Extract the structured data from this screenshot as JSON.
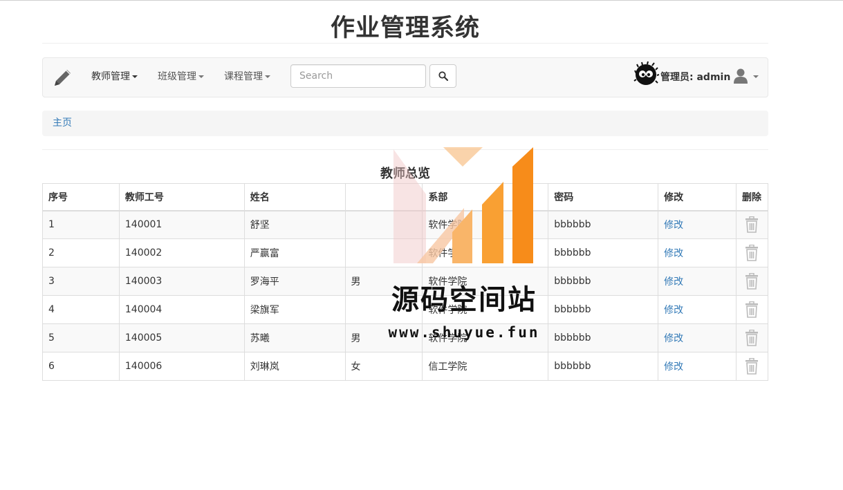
{
  "app": {
    "title": "作业管理系统"
  },
  "navbar": {
    "brand_icon": "pencil-icon",
    "menus": [
      {
        "label": "教师管理",
        "active": true
      },
      {
        "label": "班级管理",
        "active": false
      },
      {
        "label": "课程管理",
        "active": false
      }
    ],
    "search": {
      "placeholder": "Search",
      "value": "",
      "button_icon": "search-icon"
    },
    "admin_label": "管理员: admin",
    "user_icon": "user-icon"
  },
  "breadcrumb": {
    "home": "主页"
  },
  "table": {
    "caption": "教师总览",
    "columns": [
      "序号",
      "教师工号",
      "姓名",
      "",
      "系部",
      "密码",
      "修改",
      "删除"
    ],
    "edit_label": "修改",
    "rows": [
      {
        "no": "1",
        "id": "140001",
        "name": "舒坚",
        "gender": "",
        "dept": "软件学院",
        "password": "bbbbbb"
      },
      {
        "no": "2",
        "id": "140002",
        "name": "严赢富",
        "gender": "",
        "dept": "软件学院",
        "password": "bbbbbb"
      },
      {
        "no": "3",
        "id": "140003",
        "name": "罗海平",
        "gender": "男",
        "dept": "软件学院",
        "password": "bbbbbb"
      },
      {
        "no": "4",
        "id": "140004",
        "name": "梁旗军",
        "gender": "",
        "dept": "软件学院",
        "password": "bbbbbb"
      },
      {
        "no": "5",
        "id": "140005",
        "name": "苏曦",
        "gender": "男",
        "dept": "软件学院",
        "password": "bbbbbb"
      },
      {
        "no": "6",
        "id": "140006",
        "name": "刘琳岚",
        "gender": "女",
        "dept": "信工学院",
        "password": "bbbbbb"
      }
    ]
  },
  "watermark": {
    "name": "源码空间站",
    "url": "www.shuyue.fun"
  },
  "colors": {
    "link": "#337ab7",
    "navbar_bg": "#f8f8f8",
    "breadcrumb_bg": "#f5f5f5",
    "watermark_orange": "#f78c1a"
  }
}
